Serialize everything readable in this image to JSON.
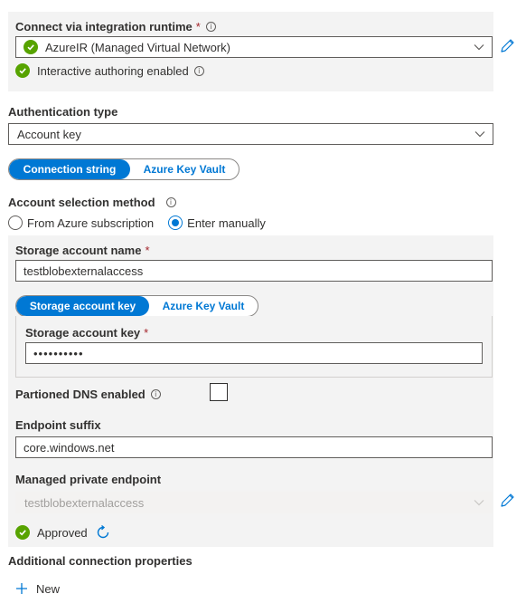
{
  "runtime": {
    "label": "Connect via integration runtime",
    "required_mark": "*",
    "selected": "AzureIR (Managed Virtual Network)",
    "status": "Interactive authoring enabled"
  },
  "auth": {
    "label": "Authentication type",
    "selected": "Account key"
  },
  "conn_toggle": {
    "options": [
      "Connection string",
      "Azure Key Vault"
    ],
    "active_index": 0
  },
  "account_selection": {
    "label": "Account selection method",
    "options": [
      "From Azure subscription",
      "Enter manually"
    ],
    "selected_index": 1
  },
  "storage_account": {
    "label": "Storage account name",
    "required_mark": "*",
    "value": "testblobexternalaccess"
  },
  "key_toggle": {
    "options": [
      "Storage account key",
      "Azure Key Vault"
    ],
    "active_index": 0
  },
  "storage_key": {
    "label": "Storage account key",
    "required_mark": "*",
    "value": "••••••••••"
  },
  "dns": {
    "label": "Partioned DNS enabled",
    "checked": false
  },
  "endpoint": {
    "label": "Endpoint suffix",
    "value": "core.windows.net"
  },
  "private_endpoint": {
    "label": "Managed private endpoint",
    "value": "testblobexternalaccess",
    "status": "Approved"
  },
  "additional": {
    "label": "Additional connection properties",
    "new_label": "New"
  },
  "colors": {
    "accent": "#0078d4",
    "success": "#57a300",
    "required": "#a4262c",
    "panel": "#f3f3f3"
  }
}
